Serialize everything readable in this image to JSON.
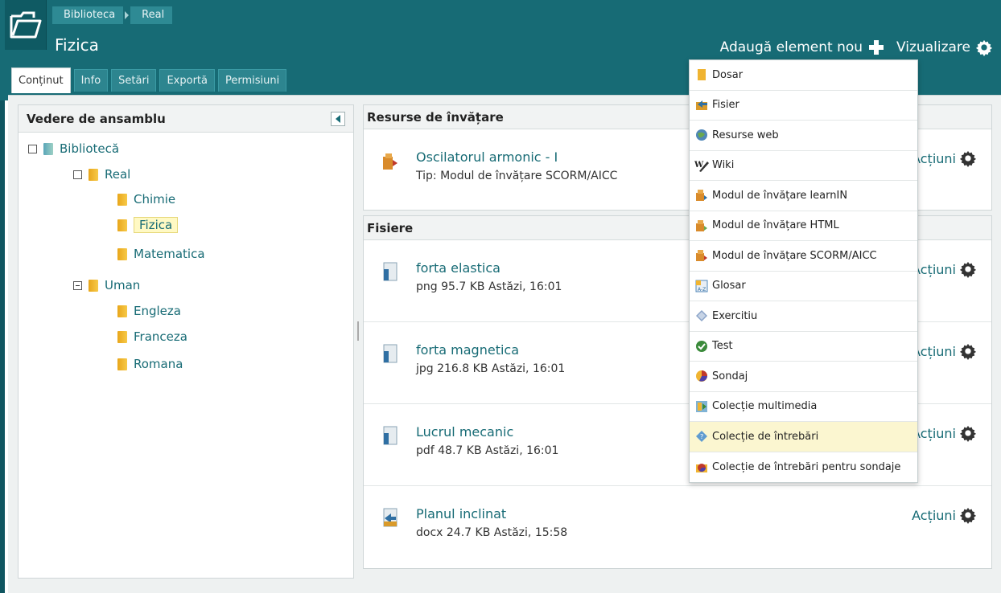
{
  "breadcrumb": [
    "Biblioteca",
    "Real"
  ],
  "page": {
    "title": "Fizica"
  },
  "top_actions": {
    "add": "Adaugă element nou",
    "view": "Vizualizare"
  },
  "tabs": [
    "Conținut",
    "Info",
    "Setări",
    "Exportă",
    "Permisiuni"
  ],
  "left_panel": {
    "header": "Vedere de ansamblu",
    "tree": [
      {
        "label": "Bibliotecă",
        "level": 0
      },
      {
        "label": "Real",
        "level": 1
      },
      {
        "label": "Chimie",
        "level": 2
      },
      {
        "label": "Fizica",
        "level": 2,
        "selected": true
      },
      {
        "label": "Matematica",
        "level": 2
      },
      {
        "label": "Uman",
        "level": 1
      },
      {
        "label": "Engleza",
        "level": 2
      },
      {
        "label": "Franceza",
        "level": 2
      },
      {
        "label": "Romana",
        "level": 2
      }
    ]
  },
  "sections": {
    "resurse": {
      "title": "Resurse de învățare",
      "items": [
        {
          "title": "Oscilatorul armonic - I",
          "meta": "Tip: Modul de învățare SCORM/AICC",
          "actions": "Acțiuni"
        }
      ]
    },
    "fisiere": {
      "title": "Fisiere",
      "items": [
        {
          "title": "forta elastica",
          "meta": "png   95.7 KB    Astăzi, 16:01",
          "actions": "Acțiuni"
        },
        {
          "title": "forta magnetica",
          "meta": "jpg   216.8 KB    Astăzi, 16:01",
          "actions": "Acțiuni"
        },
        {
          "title": "Lucrul mecanic",
          "meta": "pdf   48.7 KB    Astăzi, 16:01",
          "actions": "Acțiuni"
        },
        {
          "title": "Planul inclinat",
          "meta": "docx   24.7 KB    Astăzi, 15:58",
          "actions": "Acțiuni"
        }
      ]
    }
  },
  "dropdown": [
    {
      "label": "Dosar",
      "icon": "folder-icon"
    },
    {
      "label": "Fisier",
      "icon": "file-icon"
    },
    {
      "label": "Resurse web",
      "icon": "globe-icon"
    },
    {
      "label": "Wiki",
      "icon": "wiki-icon"
    },
    {
      "label": "Modul de învățare learnIN",
      "icon": "module-icon"
    },
    {
      "label": "Modul de învățare HTML",
      "icon": "module-icon"
    },
    {
      "label": "Modul de învățare SCORM/AICC",
      "icon": "module-icon"
    },
    {
      "label": "Glosar",
      "icon": "glossary-icon"
    },
    {
      "label": "Exercitiu",
      "icon": "exercise-icon"
    },
    {
      "label": "Test",
      "icon": "test-icon"
    },
    {
      "label": "Sondaj",
      "icon": "survey-icon"
    },
    {
      "label": "Colecție multimedia",
      "icon": "media-icon"
    },
    {
      "label": "Colecție de întrebări",
      "icon": "question-pool-icon",
      "highlighted": true
    },
    {
      "label": "Colecție de întrebări pentru sondaje",
      "icon": "survey-pool-icon"
    }
  ]
}
